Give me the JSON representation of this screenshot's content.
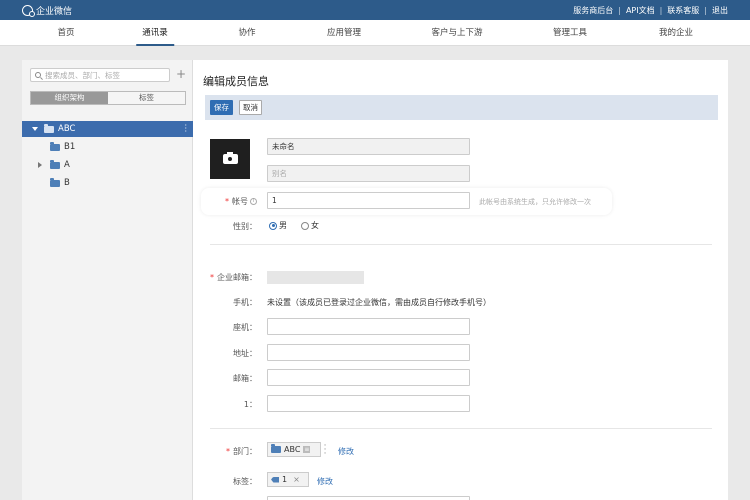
{
  "topbar": {
    "logo_text": "企业微信",
    "links": [
      "服务商后台",
      "API文档",
      "联系客服",
      "退出"
    ]
  },
  "nav": {
    "items": [
      "首页",
      "通讯录",
      "协作",
      "应用管理",
      "客户与上下游",
      "管理工具",
      "我的企业"
    ],
    "active_index": 1
  },
  "sidebar": {
    "search_placeholder": "搜索成员、部门、标签",
    "seg_org": "组织架构",
    "seg_tags": "标签",
    "tree": [
      {
        "label": "ABC",
        "selected": true
      },
      {
        "label": "B1"
      },
      {
        "label": "A"
      },
      {
        "label": "B"
      }
    ]
  },
  "main": {
    "title": "编辑成员信息",
    "save_label": "保存",
    "cancel_label": "取消",
    "name_value": "未命名",
    "alias_placeholder": "别名",
    "account_label": "帐号",
    "account_value": "1",
    "account_hint": "此帐号由系统生成，只允许修改一次",
    "gender_label": "性别：",
    "gender_male": "男",
    "gender_female": "女",
    "gender_selected": "男",
    "email_label": "企业邮箱：",
    "phone_label": "手机：",
    "phone_value": "未设置（该成员已登录过企业微信，需由成员自行修改手机号）",
    "landline_label": "座机：",
    "address_label": "地址：",
    "mailbox_label": "邮箱：",
    "custom_label": "1：",
    "dept_label": "部门：",
    "dept_chip": "ABC",
    "dept_modify": "修改",
    "tag_label": "标签：",
    "tag_chip": "1",
    "tag_remove": "×",
    "tag_modify": "修改"
  },
  "colors": {
    "topbar": "#2d5b8a",
    "primary": "#2f6db3",
    "selected_row": "#3c6cad",
    "required": "#e33333"
  }
}
